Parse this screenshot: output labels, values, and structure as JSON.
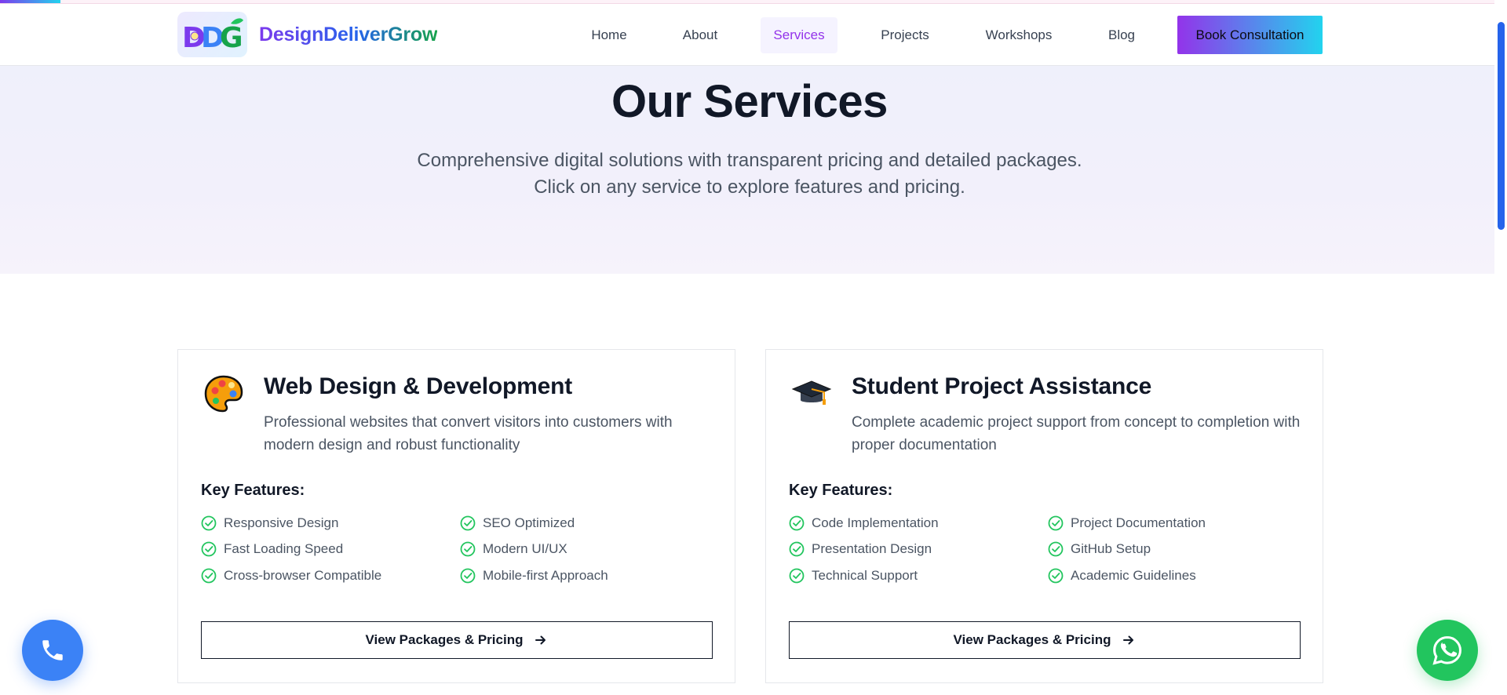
{
  "header": {
    "logo_mark": "DDG",
    "brand_name": "DesignDeliverGrow",
    "nav": [
      {
        "label": "Home",
        "active": false
      },
      {
        "label": "About",
        "active": false
      },
      {
        "label": "Services",
        "active": true
      },
      {
        "label": "Projects",
        "active": false
      },
      {
        "label": "Workshops",
        "active": false
      },
      {
        "label": "Blog",
        "active": false
      }
    ],
    "cta_label": "Book Consultation"
  },
  "hero": {
    "title": "Our Services",
    "subtitle_line1": "Comprehensive digital solutions with transparent pricing and detailed packages.",
    "subtitle_line2": "Click on any service to explore features and pricing."
  },
  "services": [
    {
      "icon": "artist-palette-icon",
      "title": "Web Design & Development",
      "description": "Professional websites that convert visitors into customers with modern design and robust functionality",
      "features_heading": "Key Features:",
      "features": [
        "Responsive Design",
        "SEO Optimized",
        "Fast Loading Speed",
        "Modern UI/UX",
        "Cross-browser Compatible",
        "Mobile-first Approach"
      ],
      "button_label": "View Packages & Pricing"
    },
    {
      "icon": "graduation-cap-icon",
      "title": "Student Project Assistance",
      "description": "Complete academic project support from concept to completion with proper documentation",
      "features_heading": "Key Features:",
      "features": [
        "Code Implementation",
        "Project Documentation",
        "Presentation Design",
        "GitHub Setup",
        "Technical Support",
        "Academic Guidelines"
      ],
      "button_label": "View Packages & Pricing"
    }
  ],
  "floating": {
    "phone_icon": "phone-icon",
    "whatsapp_icon": "whatsapp-icon"
  },
  "colors": {
    "accent_purple": "#9333ea",
    "accent_cyan": "#22d3ee",
    "check_green": "#22c55e",
    "phone_blue": "#3b82f6",
    "whatsapp_green": "#22c55e"
  },
  "scroll_progress": 0.04
}
